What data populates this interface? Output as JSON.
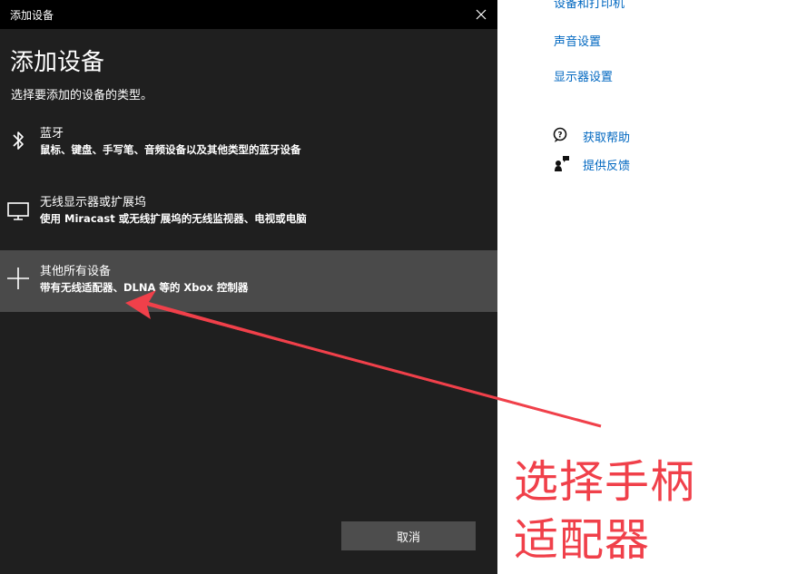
{
  "settings_links": {
    "devices_printers": "设备和打印机",
    "sound_settings": "声音设置",
    "display_settings": "显示器设置",
    "get_help": "获取帮助",
    "give_feedback": "提供反馈"
  },
  "dialog": {
    "window_title": "添加设备",
    "heading": "添加设备",
    "subheading": "选择要添加的设备的类型。",
    "options": [
      {
        "title": "蓝牙",
        "description": "鼠标、键盘、手写笔、音频设备以及其他类型的蓝牙设备",
        "icon": "bluetooth-icon"
      },
      {
        "title": "无线显示器或扩展坞",
        "description": "使用 Miracast 或无线扩展坞的无线监视器、电视或电脑",
        "icon": "monitor-icon"
      },
      {
        "title": "其他所有设备",
        "description": "带有无线适配器、DLNA 等的 Xbox 控制器",
        "icon": "plus-icon",
        "selected": true
      }
    ],
    "cancel_label": "取消"
  },
  "annotation": {
    "line1": "选择手柄",
    "line2": "适配器",
    "color": "#f0404a"
  },
  "colors": {
    "dialog_bg": "#1f1f1f",
    "titlebar_bg": "#000000",
    "selected_bg": "#4a4a4a",
    "link": "#0067c0"
  }
}
